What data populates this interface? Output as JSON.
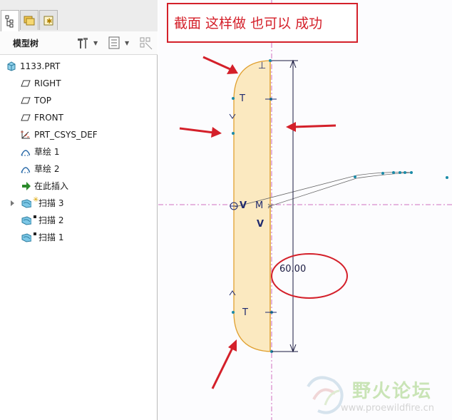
{
  "panel": {
    "tabs": [
      {
        "name": "model-tree-tab",
        "icon": "tree-icon"
      },
      {
        "name": "folder-browser-tab",
        "icon": "folder-icon"
      },
      {
        "name": "favorites-tab",
        "icon": "favorites-icon"
      }
    ],
    "title": "模型树",
    "settings_icon": "settings-tools-icon",
    "show_icon": "show-list-icon",
    "filter_icon": "filter-icon"
  },
  "tree": {
    "items": [
      {
        "label": "1133.PRT",
        "icon": "part-icon"
      },
      {
        "label": "RIGHT",
        "icon": "datum-plane-icon"
      },
      {
        "label": "TOP",
        "icon": "datum-plane-icon"
      },
      {
        "label": "FRONT",
        "icon": "datum-plane-icon"
      },
      {
        "label": "PRT_CSYS_DEF",
        "icon": "coordinate-system-icon"
      },
      {
        "label": "草绘 1",
        "icon": "sketch-icon"
      },
      {
        "label": "草绘 2",
        "icon": "sketch-icon"
      },
      {
        "label": "在此插入",
        "icon": "insert-here-arrow-icon"
      },
      {
        "label": "扫描 3",
        "icon": "sweep-icon"
      },
      {
        "label": "扫描 2",
        "icon": "sweep-icon"
      },
      {
        "label": "扫描 1",
        "icon": "sweep-icon"
      }
    ]
  },
  "canvas": {
    "annotation": "截面 这样做 也可以 成功",
    "dimension": "60.00",
    "labels": {
      "t_top": "T",
      "t_bottom": "T",
      "v_left": "V",
      "m": "M",
      "v_bottom": "V",
      "perp": "⊥"
    },
    "colors": {
      "section_fill": "#fbe9c0",
      "section_stroke": "#e0a030",
      "annotation_red": "#d4202a",
      "centerline": "#d070c0"
    }
  },
  "watermark": {
    "title": "野火论坛",
    "url": "www.proewildfire.cn"
  }
}
